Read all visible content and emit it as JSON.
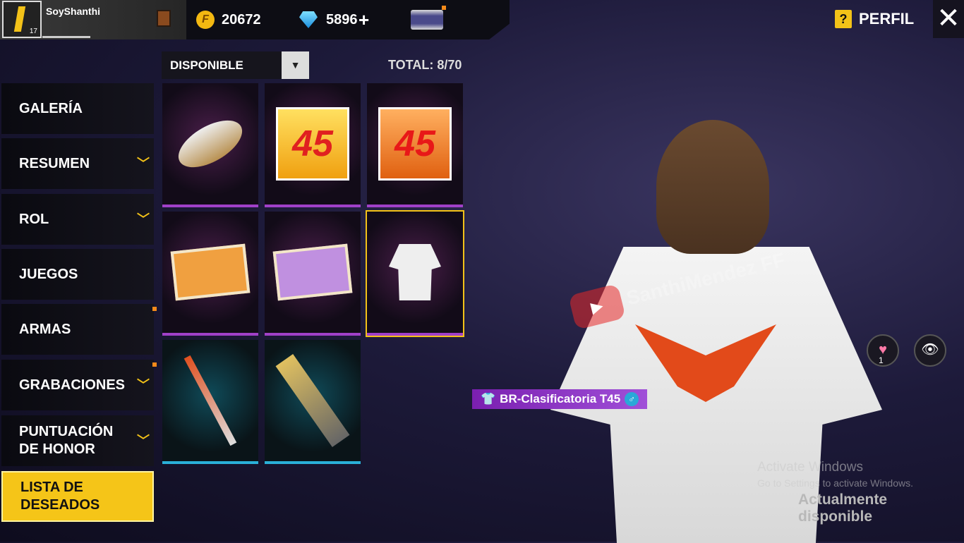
{
  "player": {
    "name": "SoyShanthi",
    "level": "17"
  },
  "currency": {
    "coins": "20672",
    "diamonds": "5896",
    "add": "+"
  },
  "header": {
    "perfil": "PERFIL",
    "help": "?",
    "close": "✕"
  },
  "filter": {
    "value": "DISPONIBLE",
    "arrow": "▼",
    "total": "TOTAL: 8/70"
  },
  "sidebar": [
    {
      "label": "GALERÍA"
    },
    {
      "label": "RESUMEN",
      "chev": "﹀"
    },
    {
      "label": "ROL",
      "chev": "﹀"
    },
    {
      "label": "JUEGOS"
    },
    {
      "label": "ARMAS"
    },
    {
      "label": "GRABACIONES",
      "chev": "﹀"
    },
    {
      "label": "PUNTUACIÓN DE HONOR",
      "chev": "﹀"
    },
    {
      "label": "LISTA DE DESEADOS"
    }
  ],
  "items": [
    {
      "label": "45"
    },
    {
      "label": "45"
    }
  ],
  "character": {
    "tag": "BR-Clasificatoria T45",
    "gender": "♂",
    "likes": "1",
    "watermark": "SanthiMendez FF"
  },
  "system": {
    "activate": "Activate Windows",
    "activate_sub": "Go to Settings to activate Windows.",
    "status": "Actualmente disponible"
  }
}
